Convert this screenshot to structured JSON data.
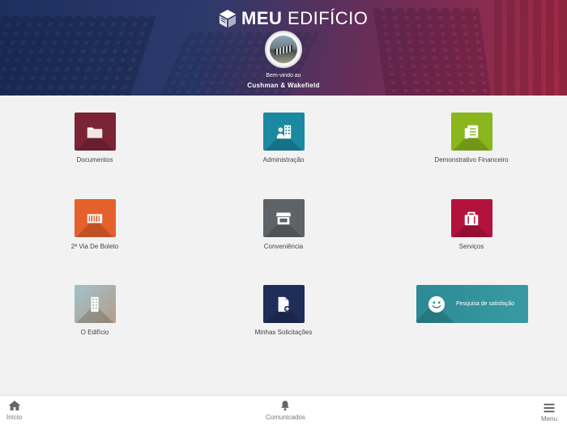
{
  "header": {
    "logo_bold": "MEU",
    "logo_light": "EDIFÍCIO",
    "welcome_line": "Bem-vindo ao",
    "building_name": "Cushman & Wakefield"
  },
  "tiles": [
    {
      "label": "Documentos",
      "color": "#7b2436",
      "icon": "folder-icon"
    },
    {
      "label": "Administração",
      "color": "#1b8aa1",
      "icon": "admin-building-icon"
    },
    {
      "label": "Demonstrativo Financeiro",
      "color": "#8ab61e",
      "icon": "document-list-icon"
    },
    {
      "label": "2ª Via De Boleto",
      "color": "#e4612b",
      "icon": "barcode-icon"
    },
    {
      "label": "Conveniência",
      "color": "#5f6366",
      "icon": "store-icon"
    },
    {
      "label": "Serviços",
      "color": "#b3123c",
      "icon": "briefcase-icon"
    },
    {
      "label": "O Edifício",
      "color": "#a6b1a8",
      "icon": "building-icon"
    },
    {
      "label": "Minhas Solicitações",
      "color": "#1f2d59",
      "icon": "add-document-icon"
    }
  ],
  "survey": {
    "label": "Pesquisa de satisfação",
    "color": "#2d8c95",
    "icon": "smiley-icon"
  },
  "bottom_nav": {
    "home": "Início",
    "notices": "Comunicados",
    "menu": "Menu"
  }
}
